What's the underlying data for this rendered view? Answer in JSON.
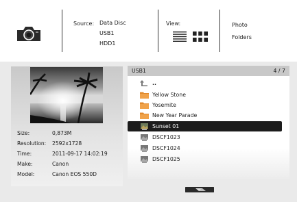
{
  "header": {
    "source": {
      "label": "Source:",
      "options": [
        "Data Disc",
        "USB1",
        "HDD1"
      ]
    },
    "view": {
      "label": "View:",
      "modes": [
        "list-icon",
        "grid-icon"
      ]
    },
    "content": {
      "options": [
        "Photo",
        "Folders"
      ]
    },
    "icon": "camera-icon"
  },
  "info": {
    "rows": [
      {
        "key": "Size:",
        "value": "0,873M"
      },
      {
        "key": "Resolution:",
        "value": "2592x1728"
      },
      {
        "key": "Time:",
        "value": "2011-09-17 14:02:19"
      },
      {
        "key": "Make:",
        "value": "Canon"
      },
      {
        "key": "Model:",
        "value": "Canon EOS 550D"
      }
    ]
  },
  "list": {
    "title": "USB1",
    "count": "4 / 7",
    "up": "..",
    "items": [
      {
        "label": "Yellow Stone",
        "type": "folder",
        "selected": false
      },
      {
        "label": "Yosemite",
        "type": "folder",
        "selected": false
      },
      {
        "label": "New Year Parade",
        "type": "folder",
        "selected": false
      },
      {
        "label": "Sunset 01",
        "type": "photo",
        "selected": true
      },
      {
        "label": "DSCF1023",
        "type": "photo",
        "selected": false
      },
      {
        "label": "DSCF1024",
        "type": "photo",
        "selected": false
      },
      {
        "label": "DSCF1025",
        "type": "photo",
        "selected": false
      }
    ]
  },
  "colors": {
    "selected_row": "#1c1c1c",
    "folder": "#e08a2e",
    "band": "#eaeaea"
  }
}
